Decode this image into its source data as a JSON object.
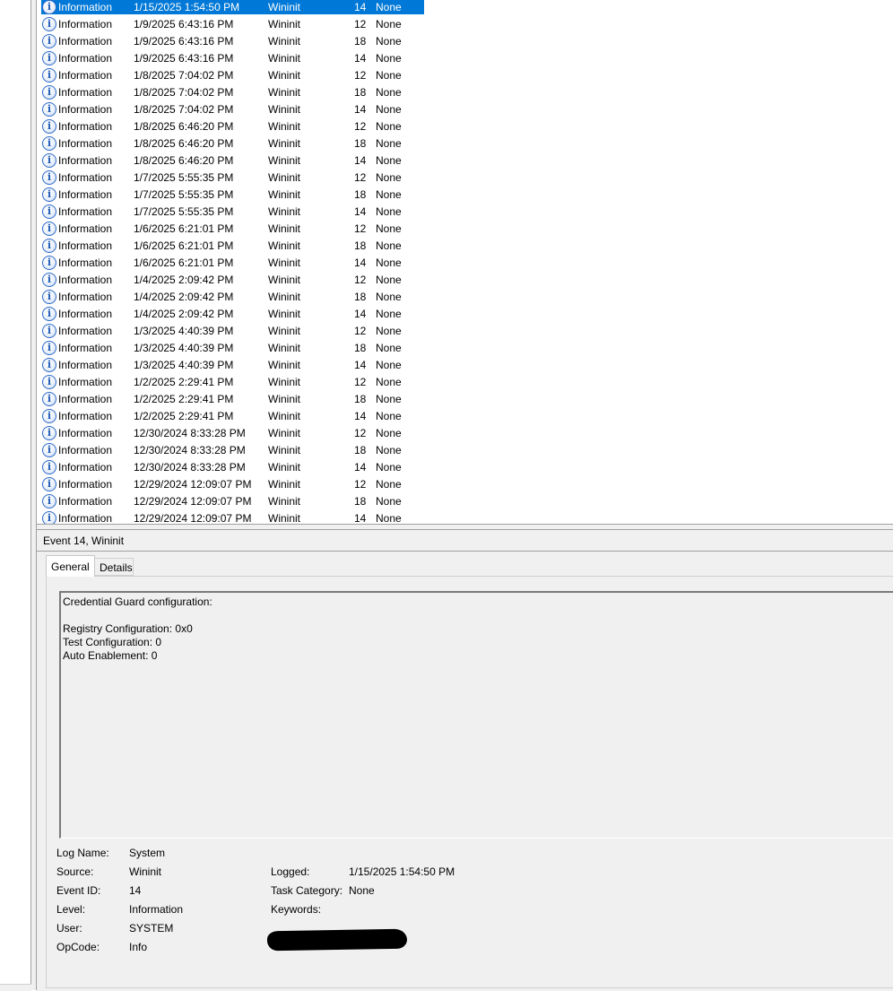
{
  "events": [
    {
      "level": "Information",
      "date": "1/15/2025 1:54:50 PM",
      "source": "Wininit",
      "id": "14",
      "task": "None",
      "selected": true
    },
    {
      "level": "Information",
      "date": "1/9/2025 6:43:16 PM",
      "source": "Wininit",
      "id": "12",
      "task": "None"
    },
    {
      "level": "Information",
      "date": "1/9/2025 6:43:16 PM",
      "source": "Wininit",
      "id": "18",
      "task": "None"
    },
    {
      "level": "Information",
      "date": "1/9/2025 6:43:16 PM",
      "source": "Wininit",
      "id": "14",
      "task": "None"
    },
    {
      "level": "Information",
      "date": "1/8/2025 7:04:02 PM",
      "source": "Wininit",
      "id": "12",
      "task": "None"
    },
    {
      "level": "Information",
      "date": "1/8/2025 7:04:02 PM",
      "source": "Wininit",
      "id": "18",
      "task": "None"
    },
    {
      "level": "Information",
      "date": "1/8/2025 7:04:02 PM",
      "source": "Wininit",
      "id": "14",
      "task": "None"
    },
    {
      "level": "Information",
      "date": "1/8/2025 6:46:20 PM",
      "source": "Wininit",
      "id": "12",
      "task": "None"
    },
    {
      "level": "Information",
      "date": "1/8/2025 6:46:20 PM",
      "source": "Wininit",
      "id": "18",
      "task": "None"
    },
    {
      "level": "Information",
      "date": "1/8/2025 6:46:20 PM",
      "source": "Wininit",
      "id": "14",
      "task": "None"
    },
    {
      "level": "Information",
      "date": "1/7/2025 5:55:35 PM",
      "source": "Wininit",
      "id": "12",
      "task": "None"
    },
    {
      "level": "Information",
      "date": "1/7/2025 5:55:35 PM",
      "source": "Wininit",
      "id": "18",
      "task": "None"
    },
    {
      "level": "Information",
      "date": "1/7/2025 5:55:35 PM",
      "source": "Wininit",
      "id": "14",
      "task": "None"
    },
    {
      "level": "Information",
      "date": "1/6/2025 6:21:01 PM",
      "source": "Wininit",
      "id": "12",
      "task": "None"
    },
    {
      "level": "Information",
      "date": "1/6/2025 6:21:01 PM",
      "source": "Wininit",
      "id": "18",
      "task": "None"
    },
    {
      "level": "Information",
      "date": "1/6/2025 6:21:01 PM",
      "source": "Wininit",
      "id": "14",
      "task": "None"
    },
    {
      "level": "Information",
      "date": "1/4/2025 2:09:42 PM",
      "source": "Wininit",
      "id": "12",
      "task": "None"
    },
    {
      "level": "Information",
      "date": "1/4/2025 2:09:42 PM",
      "source": "Wininit",
      "id": "18",
      "task": "None"
    },
    {
      "level": "Information",
      "date": "1/4/2025 2:09:42 PM",
      "source": "Wininit",
      "id": "14",
      "task": "None"
    },
    {
      "level": "Information",
      "date": "1/3/2025 4:40:39 PM",
      "source": "Wininit",
      "id": "12",
      "task": "None"
    },
    {
      "level": "Information",
      "date": "1/3/2025 4:40:39 PM",
      "source": "Wininit",
      "id": "18",
      "task": "None"
    },
    {
      "level": "Information",
      "date": "1/3/2025 4:40:39 PM",
      "source": "Wininit",
      "id": "14",
      "task": "None"
    },
    {
      "level": "Information",
      "date": "1/2/2025 2:29:41 PM",
      "source": "Wininit",
      "id": "12",
      "task": "None"
    },
    {
      "level": "Information",
      "date": "1/2/2025 2:29:41 PM",
      "source": "Wininit",
      "id": "18",
      "task": "None"
    },
    {
      "level": "Information",
      "date": "1/2/2025 2:29:41 PM",
      "source": "Wininit",
      "id": "14",
      "task": "None"
    },
    {
      "level": "Information",
      "date": "12/30/2024 8:33:28 PM",
      "source": "Wininit",
      "id": "12",
      "task": "None"
    },
    {
      "level": "Information",
      "date": "12/30/2024 8:33:28 PM",
      "source": "Wininit",
      "id": "18",
      "task": "None"
    },
    {
      "level": "Information",
      "date": "12/30/2024 8:33:28 PM",
      "source": "Wininit",
      "id": "14",
      "task": "None"
    },
    {
      "level": "Information",
      "date": "12/29/2024 12:09:07 PM",
      "source": "Wininit",
      "id": "12",
      "task": "None"
    },
    {
      "level": "Information",
      "date": "12/29/2024 12:09:07 PM",
      "source": "Wininit",
      "id": "18",
      "task": "None"
    },
    {
      "level": "Information",
      "date": "12/29/2024 12:09:07 PM",
      "source": "Wininit",
      "id": "14",
      "task": "None"
    }
  ],
  "icons": {
    "event_level": "information-icon",
    "info_glyph": "i"
  },
  "detail": {
    "title": "Event 14, Wininit",
    "tabs": {
      "general": "General",
      "details": "Details"
    },
    "description": [
      "Credential Guard configuration:",
      "",
      "Registry Configuration: 0x0",
      "Test Configuration: 0",
      "Auto Enablement: 0"
    ],
    "labels": {
      "log_name": "Log Name:",
      "source": "Source:",
      "event_id": "Event ID:",
      "level": "Level:",
      "user": "User:",
      "opcode": "OpCode:",
      "logged": "Logged:",
      "task_category": "Task Category:",
      "keywords": "Keywords:"
    },
    "values": {
      "log_name": "System",
      "source": "Wininit",
      "event_id": "14",
      "level": "Information",
      "user": "SYSTEM",
      "opcode": "Info",
      "logged": "1/15/2025 1:54:50 PM",
      "task_category": "None",
      "keywords": ""
    }
  },
  "colors": {
    "selection": "#0078d7",
    "pane_bg": "#f0f0f0",
    "border": "#a0a0a0"
  }
}
